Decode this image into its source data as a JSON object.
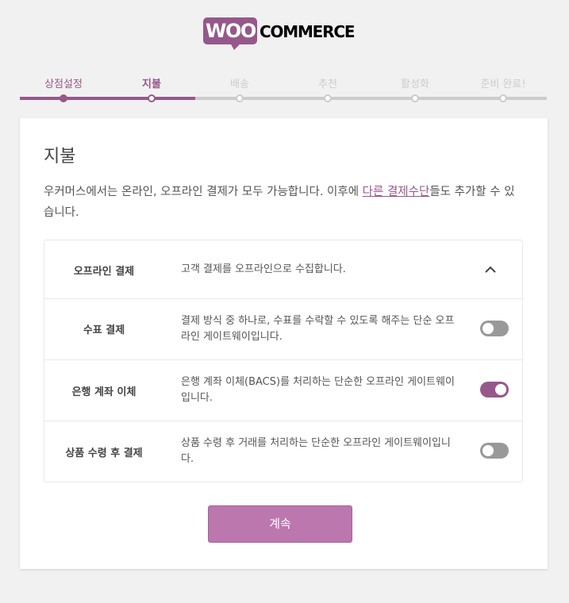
{
  "brand": {
    "color": "#96588a",
    "logo_left": "WOO",
    "logo_right": "COMMERCE"
  },
  "steps": [
    {
      "label": "상점설정",
      "state": "done"
    },
    {
      "label": "지불",
      "state": "active"
    },
    {
      "label": "배송",
      "state": "todo"
    },
    {
      "label": "추천",
      "state": "todo"
    },
    {
      "label": "활성화",
      "state": "todo"
    },
    {
      "label": "준비 완료!",
      "state": "todo"
    }
  ],
  "page": {
    "title": "지불",
    "intro_before": "우커머스에서는 온라인, 오프라인 결제가 모두 가능합니다. 이후에 ",
    "intro_link": "다른 결제수단",
    "intro_after": "들도 추가할 수 있습니다."
  },
  "section": {
    "name": "오프라인 결제",
    "desc": "고객 결제를 오프라인으로 수집합니다.",
    "expanded": true
  },
  "methods": [
    {
      "name": "수표 결제",
      "desc": "결제 방식 중 하나로, 수표를 수락할 수 있도록 해주는 단순 오프라인 게이트웨이입니다.",
      "enabled": false
    },
    {
      "name": "은행 계좌 이체",
      "desc": "은행 계좌 이체(BACS)를 처리하는 단순한 오프라인 게이트웨이입니다.",
      "enabled": true
    },
    {
      "name": "상품 수령 후 결제",
      "desc": "상품 수령 후 거래를 처리하는 단순한 오프라인 게이트웨이입니다.",
      "enabled": false
    }
  ],
  "continue_label": "계속"
}
